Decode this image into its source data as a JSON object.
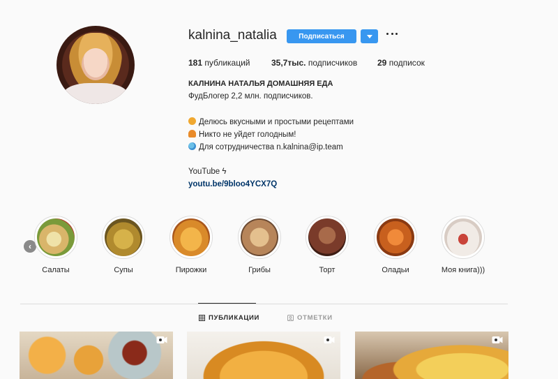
{
  "profile": {
    "username": "kalnina_natalia",
    "follow_label": "Подписаться",
    "stats": {
      "posts_count": "181",
      "posts_label": " публикаций",
      "followers_count": "35,7тыс.",
      "followers_label": " подписчиков",
      "following_count": "29",
      "following_label": " подписок"
    },
    "full_name": "КАЛНИНА НАТАЛЬЯ ДОМАШНЯЯ ЕДА",
    "bio_lines": [
      "ФудБлогер 2,2 млн. подписчиков.",
      "Делюсь вкусными и простыми рецептами",
      "Никто не уйдет голодным!",
      "Для сотрудничества n.kalnina@ip.team",
      "YouTube ϟ"
    ],
    "bio_emoji_icons": [
      "burger-emoji-icon",
      "croissant-emoji-icon",
      "globe-emoji-icon"
    ],
    "link": "youtu.be/9bloo4YCX7Q"
  },
  "highlights": [
    {
      "label": "Салаты",
      "color": "#d9b56a"
    },
    {
      "label": "Супы",
      "color": "#b08a2e"
    },
    {
      "label": "Пирожки",
      "color": "#d98a2a"
    },
    {
      "label": "Грибы",
      "color": "#b7855a"
    },
    {
      "label": "Торт",
      "color": "#7a3b2a"
    },
    {
      "label": "Оладьи",
      "color": "#c8601e"
    },
    {
      "label": "Моя книга)))",
      "color": "#e9e2de"
    }
  ],
  "tabs": [
    {
      "label": "ПУБЛИКАЦИИ",
      "active": true
    },
    {
      "label": "ОТМЕТКИ",
      "active": false
    }
  ],
  "posts": [
    {
      "type": "video",
      "color": "#e09a2e"
    },
    {
      "type": "video",
      "color": "#e8a640"
    },
    {
      "type": "video",
      "color": "#e7b84a"
    }
  ],
  "colors": {
    "accent": "#3897f0",
    "link": "#003569",
    "text": "#262626",
    "divider": "#dbdbdb"
  }
}
